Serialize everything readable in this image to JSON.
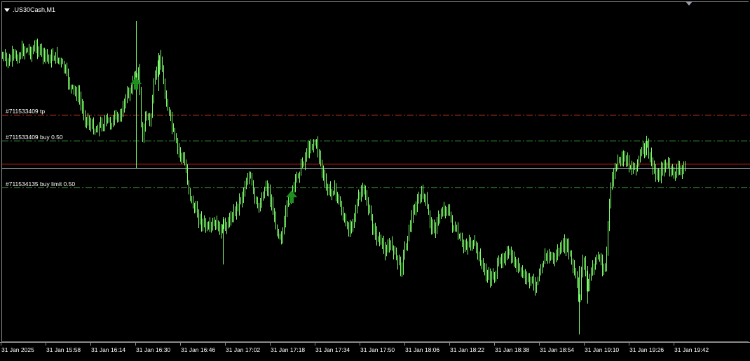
{
  "chart_window": {
    "title": ".US30Cash,M1",
    "dropdown_icon": "triangle-down-icon",
    "shift_marker_icon": "chart-shift-triangle-icon"
  },
  "colors": {
    "background": "#000000",
    "candle": "#7CFC6A",
    "buy_arrow": "#1F8F1F",
    "tp_line": "#D93A22",
    "order_line": "#3FA83F",
    "bid_line": "#E0201E",
    "ask_line": "#A8B4BC"
  },
  "levels": [
    {
      "id": "tp",
      "label": "#711533409 tp",
      "kind": "tp"
    },
    {
      "id": "buy",
      "label": "#711533409 buy 0.50",
      "kind": "order"
    },
    {
      "id": "ask",
      "label": "",
      "kind": "ask"
    },
    {
      "id": "bid",
      "label": "",
      "kind": "bid"
    },
    {
      "id": "limit",
      "label": "#711534135 buy limit 0.50",
      "kind": "order"
    }
  ],
  "time_axis": {
    "labels": [
      "31 Jan 2025",
      "31 Jan 15:58",
      "31 Jan 16:14",
      "31 Jan 16:30",
      "31 Jan 16:46",
      "31 Jan 17:02",
      "31 Jan 17:18",
      "31 Jan 17:34",
      "31 Jan 17:50",
      "31 Jan 18:06",
      "31 Jan 18:22",
      "31 Jan 18:38",
      "31 Jan 18:54",
      "31 Jan 19:10",
      "31 Jan 19:26",
      "31 Jan 19:42"
    ]
  },
  "chart_data": {
    "type": "candlestick",
    "symbol": ".US30Cash",
    "timeframe": "M1",
    "title": ".US30Cash,M1",
    "x_unit": "minute",
    "close_path": [
      [
        0,
        78
      ],
      [
        4,
        82
      ],
      [
        8,
        86
      ],
      [
        12,
        90
      ],
      [
        16,
        82
      ],
      [
        20,
        80
      ],
      [
        24,
        82
      ],
      [
        28,
        78
      ],
      [
        32,
        72
      ],
      [
        36,
        70
      ],
      [
        40,
        72
      ],
      [
        44,
        74
      ],
      [
        48,
        70
      ],
      [
        52,
        68
      ],
      [
        56,
        72
      ],
      [
        60,
        78
      ],
      [
        64,
        80
      ],
      [
        68,
        82
      ],
      [
        72,
        84
      ],
      [
        76,
        80
      ],
      [
        80,
        82
      ],
      [
        84,
        86
      ],
      [
        88,
        92
      ],
      [
        92,
        100
      ],
      [
        96,
        112
      ],
      [
        100,
        124
      ],
      [
        104,
        130
      ],
      [
        108,
        132
      ],
      [
        112,
        138
      ],
      [
        116,
        152
      ],
      [
        120,
        165
      ],
      [
        124,
        172
      ],
      [
        128,
        178
      ],
      [
        132,
        182
      ],
      [
        136,
        186
      ],
      [
        140,
        180
      ],
      [
        144,
        178
      ],
      [
        148,
        176
      ],
      [
        152,
        172
      ],
      [
        156,
        176
      ],
      [
        160,
        174
      ],
      [
        164,
        170
      ],
      [
        168,
        168
      ],
      [
        172,
        162
      ],
      [
        176,
        150
      ],
      [
        180,
        140
      ],
      [
        184,
        130
      ],
      [
        188,
        120
      ],
      [
        192,
        110
      ],
      [
        196,
        108
      ],
      [
        198,
        104
      ],
      [
        200,
        150
      ],
      [
        202,
        200
      ],
      [
        204,
        188
      ],
      [
        206,
        176
      ],
      [
        208,
        168
      ],
      [
        210,
        160
      ],
      [
        212,
        172
      ],
      [
        214,
        180
      ],
      [
        216,
        150
      ],
      [
        218,
        130
      ],
      [
        220,
        118
      ],
      [
        222,
        110
      ],
      [
        224,
        100
      ],
      [
        226,
        90
      ],
      [
        228,
        80
      ],
      [
        230,
        90
      ],
      [
        232,
        110
      ],
      [
        234,
        130
      ],
      [
        236,
        140
      ],
      [
        238,
        148
      ],
      [
        240,
        160
      ],
      [
        244,
        176
      ],
      [
        248,
        196
      ],
      [
        252,
        210
      ],
      [
        256,
        218
      ],
      [
        260,
        228
      ],
      [
        264,
        236
      ],
      [
        266,
        250
      ],
      [
        268,
        264
      ],
      [
        272,
        284
      ],
      [
        276,
        296
      ],
      [
        280,
        304
      ],
      [
        284,
        312
      ],
      [
        288,
        318
      ],
      [
        292,
        322
      ],
      [
        296,
        330
      ],
      [
        300,
        326
      ],
      [
        304,
        322
      ],
      [
        308,
        320
      ],
      [
        312,
        326
      ],
      [
        316,
        332
      ],
      [
        320,
        322
      ],
      [
        324,
        318
      ],
      [
        328,
        312
      ],
      [
        332,
        306
      ],
      [
        336,
        298
      ],
      [
        340,
        290
      ],
      [
        344,
        282
      ],
      [
        348,
        268
      ],
      [
        352,
        256
      ],
      [
        356,
        250
      ],
      [
        360,
        270
      ],
      [
        364,
        290
      ],
      [
        368,
        300
      ],
      [
        372,
        286
      ],
      [
        376,
        272
      ],
      [
        380,
        262
      ],
      [
        384,
        280
      ],
      [
        388,
        298
      ],
      [
        392,
        316
      ],
      [
        396,
        330
      ],
      [
        400,
        338
      ],
      [
        404,
        330
      ],
      [
        406,
        314
      ],
      [
        408,
        300
      ],
      [
        410,
        292
      ],
      [
        412,
        284
      ],
      [
        416,
        276
      ],
      [
        420,
        262
      ],
      [
        424,
        250
      ],
      [
        428,
        240
      ],
      [
        432,
        232
      ],
      [
        436,
        220
      ],
      [
        440,
        212
      ],
      [
        444,
        206
      ],
      [
        448,
        202
      ],
      [
        452,
        210
      ],
      [
        456,
        226
      ],
      [
        460,
        250
      ],
      [
        464,
        266
      ],
      [
        468,
        274
      ],
      [
        472,
        272
      ],
      [
        476,
        270
      ],
      [
        480,
        280
      ],
      [
        484,
        290
      ],
      [
        488,
        304
      ],
      [
        492,
        320
      ],
      [
        496,
        332
      ],
      [
        500,
        320
      ],
      [
        504,
        308
      ],
      [
        508,
        296
      ],
      [
        512,
        282
      ],
      [
        516,
        272
      ],
      [
        520,
        276
      ],
      [
        524,
        294
      ],
      [
        528,
        312
      ],
      [
        532,
        326
      ],
      [
        536,
        336
      ],
      [
        540,
        344
      ],
      [
        544,
        350
      ],
      [
        548,
        358
      ],
      [
        552,
        354
      ],
      [
        556,
        350
      ],
      [
        560,
        352
      ],
      [
        564,
        364
      ],
      [
        568,
        376
      ],
      [
        572,
        382
      ],
      [
        576,
        362
      ],
      [
        580,
        340
      ],
      [
        584,
        324
      ],
      [
        588,
        308
      ],
      [
        592,
        296
      ],
      [
        596,
        286
      ],
      [
        600,
        280
      ],
      [
        604,
        276
      ],
      [
        608,
        294
      ],
      [
        612,
        312
      ],
      [
        616,
        324
      ],
      [
        620,
        326
      ],
      [
        624,
        316
      ],
      [
        628,
        306
      ],
      [
        632,
        300
      ],
      [
        636,
        296
      ],
      [
        640,
        306
      ],
      [
        644,
        318
      ],
      [
        648,
        328
      ],
      [
        652,
        336
      ],
      [
        656,
        344
      ],
      [
        660,
        352
      ],
      [
        664,
        350
      ],
      [
        668,
        346
      ],
      [
        672,
        348
      ],
      [
        676,
        352
      ],
      [
        680,
        360
      ],
      [
        684,
        370
      ],
      [
        688,
        380
      ],
      [
        692,
        390
      ],
      [
        696,
        396
      ],
      [
        700,
        398
      ],
      [
        704,
        392
      ],
      [
        708,
        386
      ],
      [
        712,
        376
      ],
      [
        716,
        368
      ],
      [
        720,
        362
      ],
      [
        724,
        364
      ],
      [
        728,
        368
      ],
      [
        732,
        374
      ],
      [
        736,
        378
      ],
      [
        740,
        384
      ],
      [
        744,
        392
      ],
      [
        748,
        396
      ],
      [
        752,
        398
      ],
      [
        756,
        400
      ],
      [
        760,
        408
      ],
      [
        764,
        406
      ],
      [
        768,
        392
      ],
      [
        772,
        378
      ],
      [
        776,
        370
      ],
      [
        780,
        364
      ],
      [
        784,
        366
      ],
      [
        788,
        370
      ],
      [
        792,
        366
      ],
      [
        796,
        360
      ],
      [
        800,
        356
      ],
      [
        804,
        352
      ],
      [
        808,
        350
      ],
      [
        812,
        362
      ],
      [
        816,
        380
      ],
      [
        820,
        392
      ],
      [
        824,
        414
      ],
      [
        826,
        440
      ],
      [
        828,
        400
      ],
      [
        830,
        376
      ],
      [
        832,
        366
      ],
      [
        834,
        380
      ],
      [
        836,
        400
      ],
      [
        838,
        420
      ],
      [
        840,
        402
      ],
      [
        844,
        386
      ],
      [
        848,
        374
      ],
      [
        852,
        366
      ],
      [
        856,
        372
      ],
      [
        860,
        386
      ],
      [
        864,
        380
      ],
      [
        866,
        340
      ],
      [
        868,
        300
      ],
      [
        870,
        280
      ],
      [
        874,
        250
      ],
      [
        878,
        238
      ],
      [
        882,
        232
      ],
      [
        886,
        230
      ],
      [
        890,
        222
      ],
      [
        894,
        228
      ],
      [
        898,
        236
      ],
      [
        902,
        242
      ],
      [
        906,
        238
      ],
      [
        910,
        228
      ],
      [
        914,
        220
      ],
      [
        918,
        214
      ],
      [
        922,
        208
      ],
      [
        926,
        222
      ],
      [
        930,
        236
      ],
      [
        934,
        248
      ],
      [
        938,
        252
      ],
      [
        942,
        246
      ],
      [
        946,
        238
      ],
      [
        950,
        236
      ],
      [
        954,
        240
      ],
      [
        958,
        246
      ],
      [
        962,
        248
      ],
      [
        966,
        244
      ],
      [
        970,
        240
      ],
      [
        974,
        242
      ]
    ],
    "buy_markers": [
      [
        194,
        120
      ],
      [
        416,
        282
      ]
    ],
    "y_price_axis": "not shown"
  }
}
